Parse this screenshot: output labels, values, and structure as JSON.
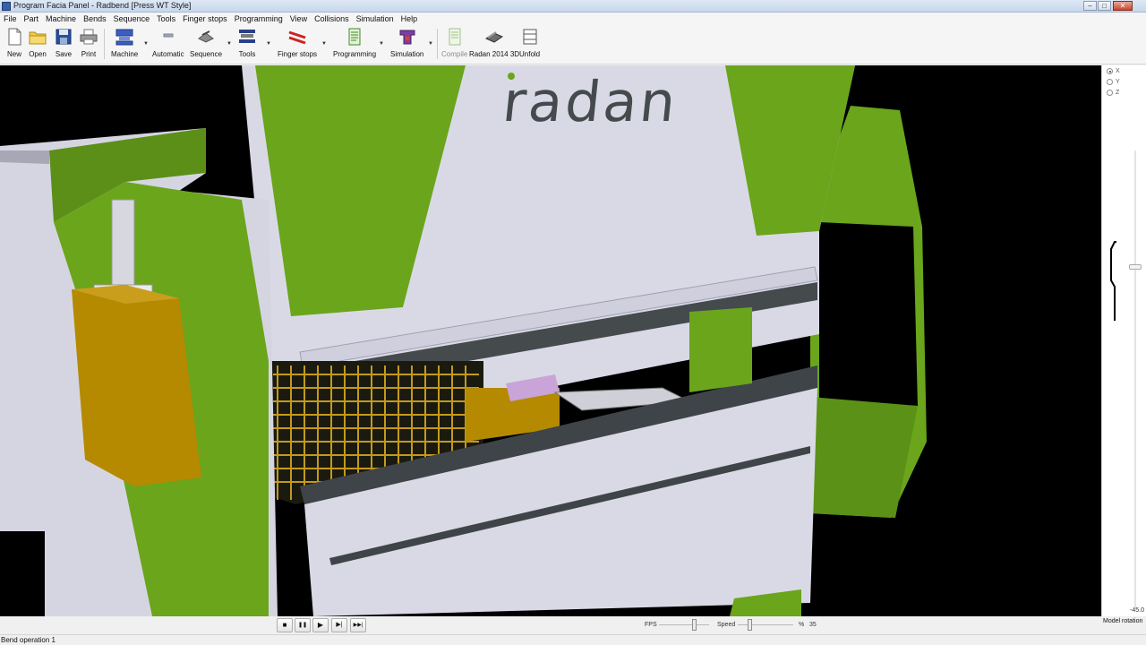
{
  "window": {
    "title": "Program Facia Panel - Radbend [Press WT Style]",
    "controls": {
      "minimize": "–",
      "maximize": "□",
      "close": "✕"
    }
  },
  "menu": [
    "File",
    "Part",
    "Machine",
    "Bends",
    "Sequence",
    "Tools",
    "Finger stops",
    "Programming",
    "View",
    "Collisions",
    "Simulation",
    "Help"
  ],
  "toolbar": {
    "new": "New",
    "open": "Open",
    "save": "Save",
    "print": "Print",
    "machine": "Machine",
    "automatic": "Automatic",
    "sequence": "Sequence",
    "tools": "Tools",
    "finger_stops": "Finger stops",
    "programming": "Programming",
    "simulation": "Simulation",
    "compile": "Compile",
    "radan3d": "Radan 2014 3D",
    "unfold": "Unfold"
  },
  "viewport": {
    "brand_text": "radan",
    "colors": {
      "frame_green": "#6aa51c",
      "frame_light": "#d5d5e2",
      "yellow_block": "#b58a00",
      "beam_dark": "#4a4f52"
    }
  },
  "side_panel": {
    "axes": [
      {
        "label": "X",
        "selected": true
      },
      {
        "label": "Y",
        "selected": false
      },
      {
        "label": "Z",
        "selected": false
      }
    ],
    "rotation_value": "-45.0",
    "rotation_label": "Model rotation"
  },
  "playback": {
    "stop": "■",
    "pause": "❚❚",
    "play": "▶",
    "step": "▶|",
    "end": "▶▶|",
    "fps_label": "FPS",
    "speed_label": "Speed",
    "speed_unit": "%",
    "speed_value": "35"
  },
  "status": {
    "text": "Bend operation 1"
  }
}
